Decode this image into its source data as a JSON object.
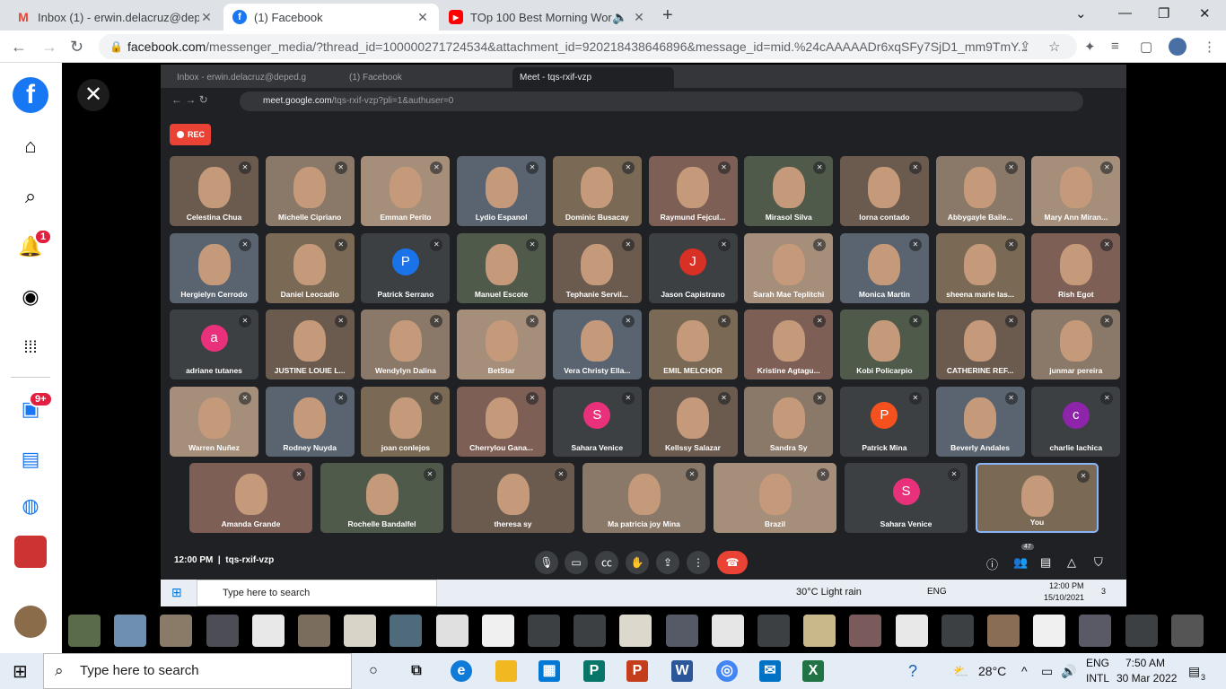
{
  "browser": {
    "tabs": [
      {
        "title": "Inbox (1) - erwin.delacruz@depe",
        "icon": "gmail-icon"
      },
      {
        "title": "(1) Facebook",
        "icon": "facebook-icon"
      },
      {
        "title": "TOp 100 Best Morning Worsl",
        "icon": "youtube-icon"
      }
    ],
    "url_domain": "facebook.com",
    "url_path": "/messenger_media/?thread_id=100000271724534&attachment_id=920218438646896&message_id=mid.%24cAAAAADr6xqSFy7SjD1_mm9TmY..."
  },
  "facebook_rail": {
    "notifications_badge": "1",
    "watch_badge": "9+"
  },
  "inner_browser": {
    "tabs": [
      "Inbox - erwin.delacruz@deped.g",
      "(1) Facebook",
      "Meet - tqs-rxif-vzp"
    ],
    "url_domain": "meet.google.com",
    "url_path": "/tqs-rxif-vzp?pli=1&authuser=0"
  },
  "meet": {
    "rec_label": "REC",
    "time": "12:00 PM",
    "meeting_code": "tqs-rxif-vzp",
    "participants_count": "47",
    "rows": [
      [
        "Celestina Chua",
        "Michelle Cipriano",
        "Emman Perito",
        "Lydio Espanol",
        "Dominic Busacay",
        "Raymund Fejcul...",
        "Mirasol Silva",
        "lorna contado",
        "Abbygayle Baile...",
        "Mary Ann Miran..."
      ],
      [
        "Hergielyn Cerrodo",
        "Daniel Leocadio",
        "Patrick Serrano",
        "Manuel Escote",
        "Tephanie Servil...",
        "Jason Capistrano",
        "Sarah Mae Teplitchi",
        "Monica Martin",
        "sheena marie las...",
        "Rish Egot"
      ],
      [
        "adriane tutanes",
        "JUSTINE LOUIE L...",
        "Wendylyn Dalina",
        "BetStar",
        "Vera Christy Ella...",
        "EMIL MELCHOR",
        "Kristine Agtagu...",
        "Kobi Policarpio",
        "CATHERINE REF...",
        "junmar pereira"
      ],
      [
        "Warren Nuñez",
        "Rodney Nuyda",
        "joan conlejos",
        "Cherrylou Gana...",
        "Sahara Venice",
        "Kellssy Salazar",
        "Sandra Sy",
        "Patrick Mina",
        "Beverly Andales",
        "charlie lachica"
      ]
    ],
    "last_row": [
      "Amanda Grande",
      "Rochelle Bandalfel",
      "theresa sy",
      "Ma patricia joy Mina",
      "Brazil",
      "Sahara Venice",
      "You"
    ],
    "avatar_letters": {
      "Patrick Serrano": "P",
      "Jason Capistrano": "J",
      "adriane tutanes": "a",
      "Sahara Venice": "S",
      "Patrick Mina": "P",
      "charlie lachica": "c"
    },
    "colors": {
      "p_blue": "#1a73e8",
      "j_red": "#d93025",
      "pink": "#e8317a",
      "orange": "#f4511e",
      "purple": "#8e24aa",
      "end_red": "#ea4335"
    }
  },
  "inner_taskbar": {
    "search": "Type here to search",
    "weather": "30°C  Light rain",
    "lang": "ENG",
    "time": "12:00 PM",
    "date": "15/10/2021",
    "notif": "3"
  },
  "taskbar": {
    "search": "Type here to search",
    "weather": "28°C",
    "lang1": "ENG",
    "lang2": "INTL",
    "time": "7:50 AM",
    "date": "30 Mar 2022",
    "notif": "3"
  }
}
